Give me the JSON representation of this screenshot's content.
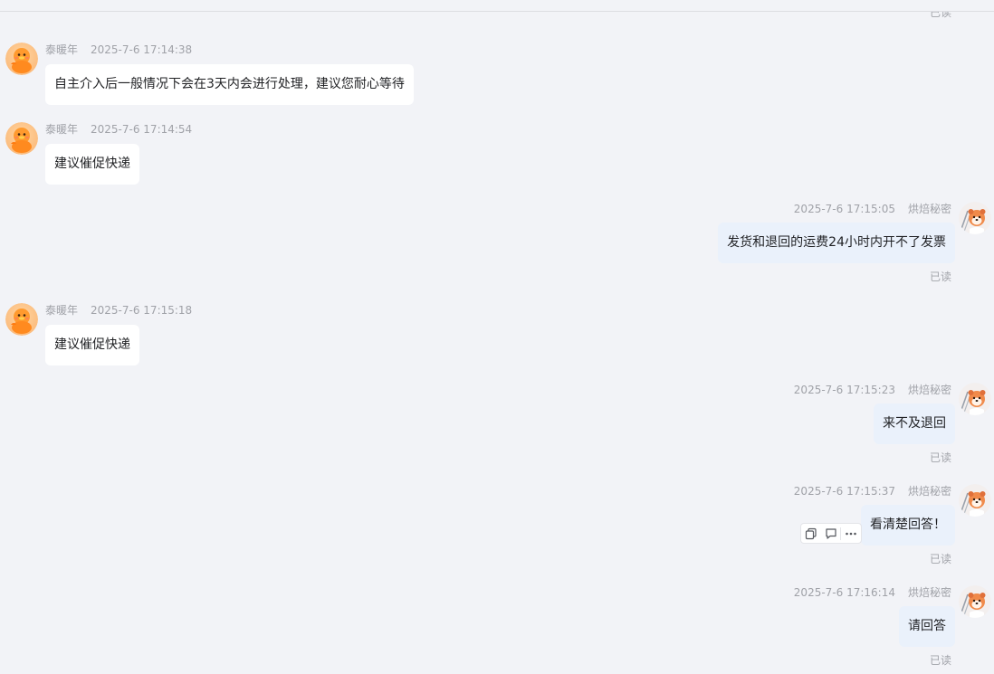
{
  "peer": {
    "name": "泰暖年"
  },
  "me": {
    "name": "烘焙秘密"
  },
  "read_label": "已读",
  "messages": [
    {
      "time": "2025-7-6 17:14:38",
      "text": "自主介入后一般情况下会在3天内会进行处理，建议您耐心等待"
    },
    {
      "time": "2025-7-6 17:14:54",
      "text": "建议催促快递"
    },
    {
      "time": "2025-7-6 17:15:05",
      "text": "发货和退回的运费24小时内开不了发票"
    },
    {
      "time": "2025-7-6 17:15:18",
      "text": "建议催促快递"
    },
    {
      "time": "2025-7-6 17:15:23",
      "text": "来不及退回"
    },
    {
      "time": "2025-7-6 17:15:37",
      "text": "看清楚回答！"
    },
    {
      "time": "2025-7-6 17:16:14",
      "text": "请回答"
    }
  ],
  "hover_toolbar": {
    "icons": [
      "copy-icon",
      "quote-reply-icon",
      "more-icon"
    ]
  },
  "colors": {
    "background": "#f2f3f7",
    "incoming_bubble": "#ffffff",
    "outgoing_bubble": "#eaf1fb",
    "meta_text": "#a0a2a8"
  }
}
